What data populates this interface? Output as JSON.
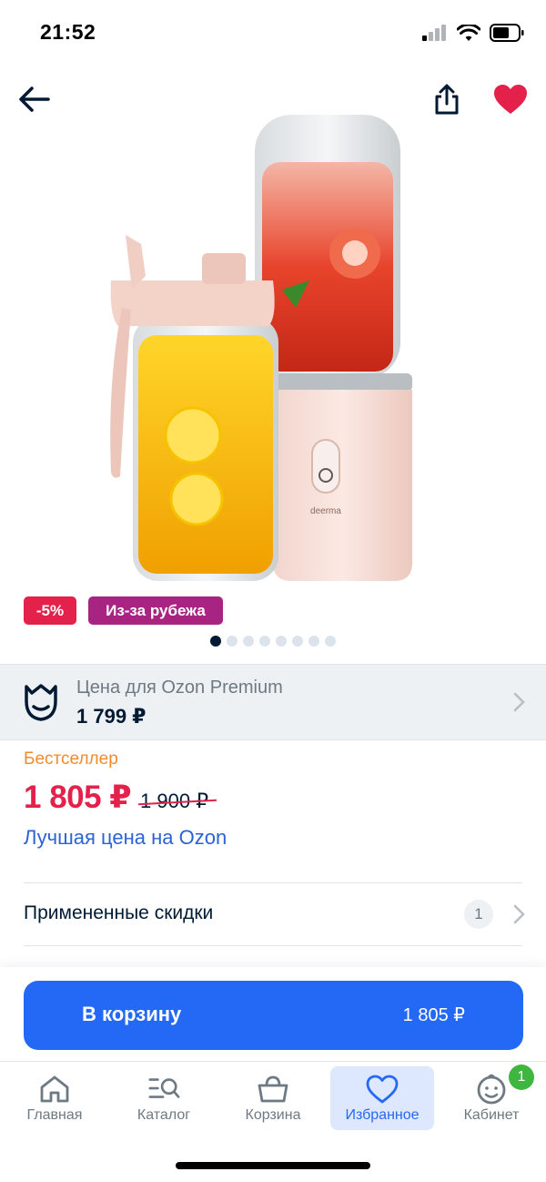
{
  "status_bar": {
    "time": "21:52"
  },
  "product": {
    "badges": {
      "discount": "-5%",
      "origin": "Из-за рубежа"
    },
    "image_dots": {
      "count": 8,
      "active_index": 0
    },
    "image_label": "deerma"
  },
  "premium": {
    "title": "Цена для Ozon Premium",
    "price": "1 799 ₽"
  },
  "pricing": {
    "bestseller": "Бестселлер",
    "current": "1 805 ₽",
    "old": "1 900 ₽",
    "best_price_link": "Лучшая цена на Ozon"
  },
  "discounts": {
    "label": "Примененные скидки",
    "count": "1"
  },
  "cta": {
    "label": "В корзину",
    "price": "1 805 ₽"
  },
  "nav": {
    "items": [
      {
        "label": "Главная",
        "icon": "home-icon"
      },
      {
        "label": "Каталог",
        "icon": "catalog-search-icon"
      },
      {
        "label": "Корзина",
        "icon": "cart-icon"
      },
      {
        "label": "Избранное",
        "icon": "heart-icon",
        "active": true
      },
      {
        "label": "Кабинет",
        "icon": "profile-icon",
        "badge": "1"
      }
    ]
  },
  "colors": {
    "accent_blue": "#2369f6",
    "price_red": "#e3214a",
    "bestseller_orange": "#f28c2b",
    "origin_purple": "#a72482",
    "favorite_heart": "#e3214a"
  }
}
